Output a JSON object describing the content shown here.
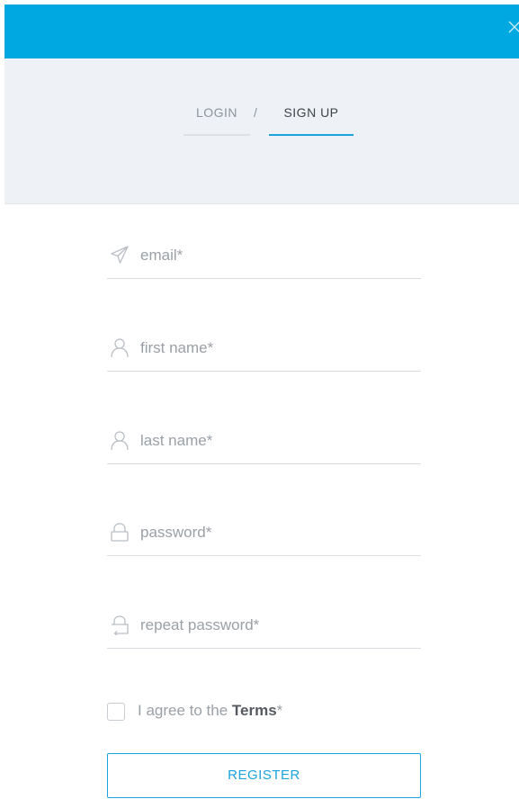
{
  "header": {
    "close_icon": "close-icon",
    "accent_color": "#00a8e1"
  },
  "tabs": {
    "login_label": "LOGIN",
    "separator": "/",
    "signup_label": "SIGN UP",
    "active": "SIGN UP"
  },
  "form": {
    "fields": [
      {
        "name": "email",
        "placeholder": "email*",
        "value": "",
        "icon": "paper-plane-icon"
      },
      {
        "name": "first_name",
        "placeholder": "first name*",
        "value": "",
        "icon": "user-icon"
      },
      {
        "name": "last_name",
        "placeholder": "last name*",
        "value": "",
        "icon": "user-icon"
      },
      {
        "name": "password",
        "placeholder": "password*",
        "value": "",
        "icon": "lock-icon"
      },
      {
        "name": "repeat_password",
        "placeholder": "repeat password*",
        "value": "",
        "icon": "lock-repeat-icon"
      }
    ],
    "terms": {
      "prefix": "I agree to the ",
      "link": "Terms",
      "suffix": "*",
      "checked": false
    },
    "register_label": "REGISTER"
  }
}
